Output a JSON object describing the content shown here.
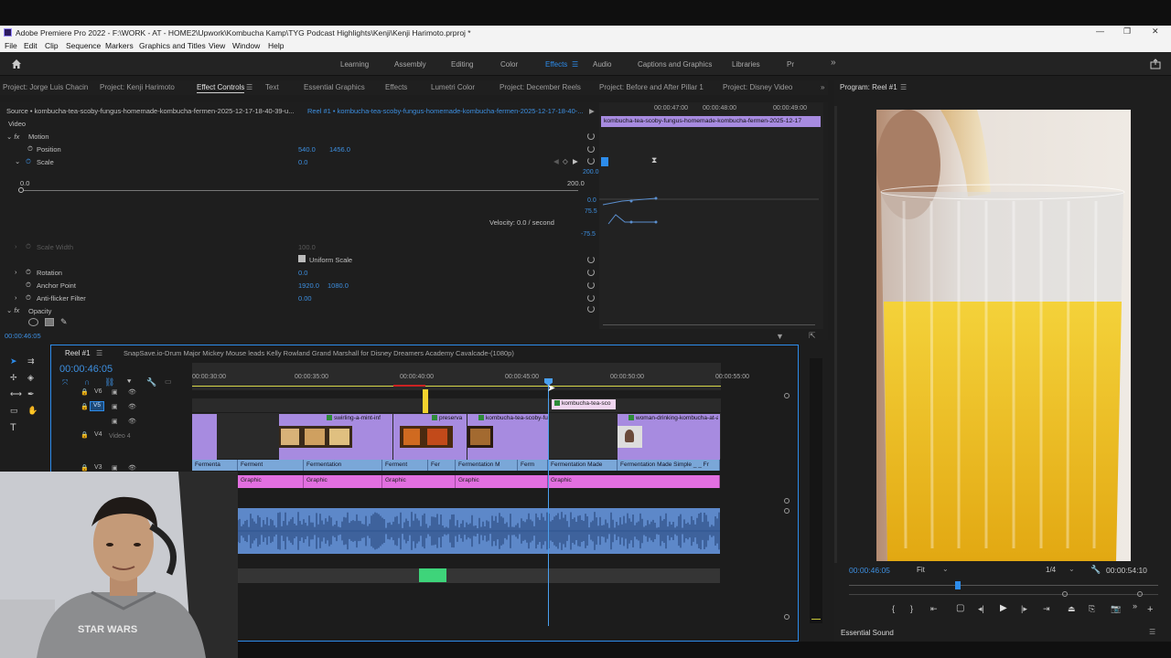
{
  "window": {
    "title": "Adobe Premiere Pro 2022 - F:\\WORK - AT - HOME2\\Upwork\\Kombucha Kamp\\TYG Podcast Highlights\\Kenji\\Kenji Harimoto.prproj *",
    "minimize": "—",
    "maximize": "❐",
    "close": "✕"
  },
  "menu": [
    "File",
    "Edit",
    "Clip",
    "Sequence",
    "Markers",
    "Graphics and Titles",
    "View",
    "Window",
    "Help"
  ],
  "workspaces": {
    "items": [
      "Learning",
      "Assembly",
      "Editing",
      "Color",
      "Effects",
      "Audio",
      "Captions and Graphics",
      "Libraries",
      "Pr"
    ],
    "active": "Effects"
  },
  "panel_tabs": [
    "Project: Jorge Luis Chacin",
    "Project: Kenji Harimoto",
    "Effect Controls",
    "Text",
    "Essential Graphics",
    "Effects",
    "Lumetri Color",
    "Project: December Reels",
    "Project: Before and After Pillar 1",
    "Project: Disney Video"
  ],
  "program_tab": "Program: Reel #1",
  "effect_controls": {
    "source": "Source • kombucha-tea-scoby-fungus-homemade-kombucha-fermen-2025-12-17-18-40-39-u...",
    "sequence": "Reel #1 • kombucha-tea-scoby-fungus-homemade-kombucha-fermen-2025-12-17-18-40-...",
    "video_label": "Video",
    "motion": "Motion",
    "position_label": "Position",
    "position_x": "540.0",
    "position_y": "1456.0",
    "scale_label": "Scale",
    "scale_value": "0.0",
    "slider_min": "0.0",
    "slider_max": "200.0",
    "velocity": "Velocity: 0.0 / second",
    "scale_width_label": "Scale Width",
    "scale_width_value": "100.0",
    "uniform_scale": "Uniform Scale",
    "rotation_label": "Rotation",
    "rotation_value": "0.0",
    "anchor_label": "Anchor Point",
    "anchor_x": "1920.0",
    "anchor_y": "1080.0",
    "antiflicker_label": "Anti-flicker Filter",
    "antiflicker_value": "0.00",
    "opacity_label": "Opacity",
    "graph_top": "200.0",
    "graph_zero": "0.0",
    "graph_p75": "75.5",
    "graph_n75": "-75.5",
    "timecode": "00:00:46:05"
  },
  "mini_timeline": {
    "ticks": [
      "00:00:47:00",
      "00:00:48:00",
      "00:00:49:00"
    ],
    "clip": "kombucha-tea-scoby-fungus-homemade-kombucha-fermen-2025-12-17"
  },
  "timeline": {
    "tab": "Reel #1",
    "other_tab": "SnapSave.io-Drum Major Mickey Mouse leads Kelly Rowland Grand Marshall for Disney Dreamers Academy Cavalcade-(1080p)",
    "timecode": "00:00:46:05",
    "ticks": [
      "00:00:30:00",
      "00:00:35:00",
      "00:00:40:00",
      "00:00:45:00",
      "00:00:50:00",
      "00:00:55:00"
    ],
    "tracks": [
      "V6",
      "V5",
      "V4",
      "V3"
    ],
    "track_v4_name": "Video 4",
    "v5_clip": "kombucha-tea-sco",
    "v4_clips": [
      "swirling-a-mint-inf",
      "preserva",
      "kombucha-tea-scoby-fun",
      "woman-drinking-kombucha-at-a-t"
    ],
    "text_clips": [
      "Fermenta",
      "Ferment",
      "Fermentation",
      "Ferment",
      "Fer",
      "Fermentation M",
      "Ferm",
      "Fermentation Made",
      "Fermentation Made Simple _ _ Fr"
    ],
    "graphic_clips": [
      "Graphic",
      "Graphic",
      "Graphic",
      "Graphic",
      "Graphic"
    ]
  },
  "program": {
    "timecode": "00:00:46:05",
    "fit": "Fit",
    "resolution": "1/4",
    "duration": "00:00:54:10"
  },
  "essential_sound": "Essential Sound",
  "colors": {
    "accent": "#2d8ceb",
    "clip_purple": "#a78be0",
    "graphic_pink": "#e26fe0",
    "audio_blue": "#5d88c9"
  }
}
